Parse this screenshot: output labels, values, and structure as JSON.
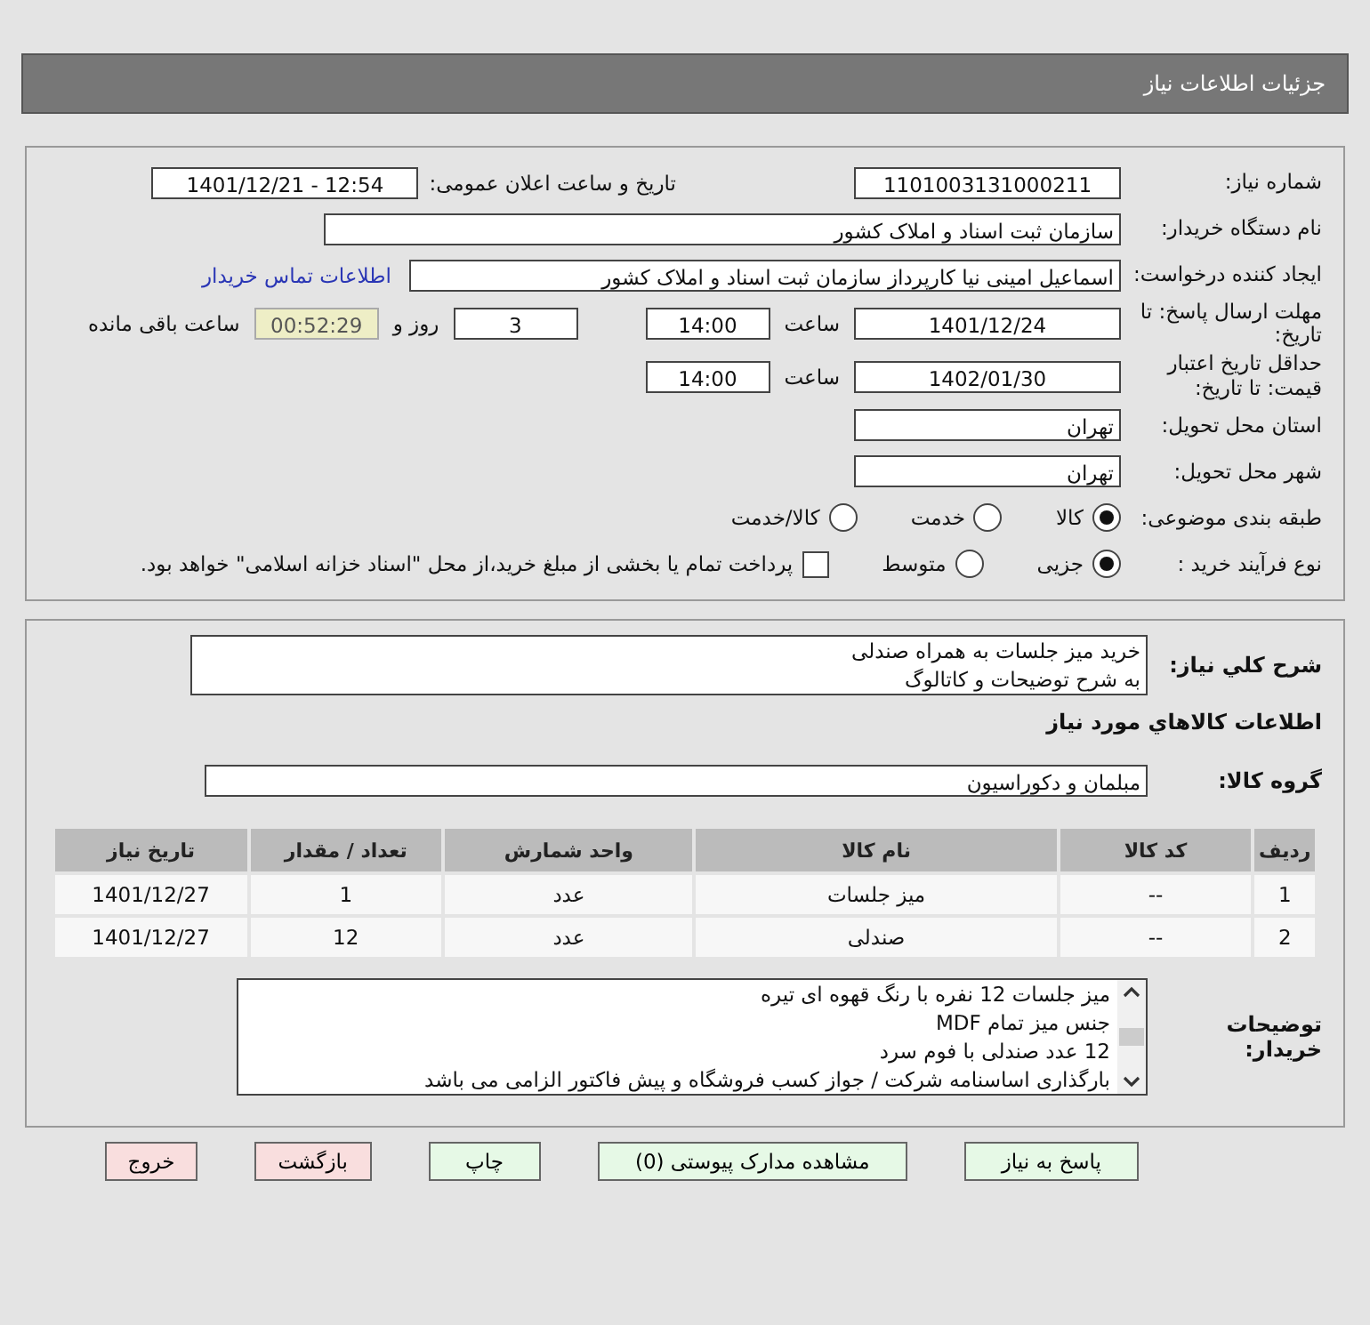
{
  "header": {
    "title": "جزئیات اطلاعات نیاز"
  },
  "details": {
    "need_number": {
      "label": "شماره نیاز:",
      "value": "1101003131000211"
    },
    "announce": {
      "label": "تاریخ و ساعت اعلان عمومی:",
      "value": "1401/12/21 - 12:54"
    },
    "buyer_org": {
      "label": "نام دستگاه خریدار:",
      "value": "سازمان ثبت اسناد و املاک کشور"
    },
    "creator": {
      "label": "ایجاد کننده درخواست:",
      "value": "اسماعیل امینی نیا کارپرداز سازمان ثبت اسناد و املاک کشور",
      "link": "اطلاعات تماس خریدار"
    },
    "deadline": {
      "label": "مهلت ارسال پاسخ: تا تاریخ:",
      "date": "1401/12/24",
      "time_label": "ساعت",
      "time": "14:00",
      "days": "3",
      "days_label": "روز و",
      "remaining": "00:52:29",
      "remaining_label": "ساعت باقی مانده"
    },
    "validity": {
      "label": "حداقل تاریخ اعتبار قیمت: تا تاریخ:",
      "date": "1402/01/30",
      "time_label": "ساعت",
      "time": "14:00"
    },
    "province": {
      "label": "استان محل تحویل:",
      "value": "تهران"
    },
    "city": {
      "label": "شهر محل تحویل:",
      "value": "تهران"
    },
    "category": {
      "label": "طبقه بندی موضوعی:",
      "options": [
        {
          "label": "کالا",
          "selected": true
        },
        {
          "label": "خدمت",
          "selected": false
        },
        {
          "label": "کالا/خدمت",
          "selected": false
        }
      ]
    },
    "process": {
      "label": "نوع فرآیند خرید :",
      "options": [
        {
          "label": "جزیی",
          "selected": true
        },
        {
          "label": "متوسط",
          "selected": false
        }
      ],
      "payment": {
        "checked": false,
        "text": "پرداخت تمام یا بخشی از مبلغ خرید،از محل \"اسناد خزانه اسلامی\" خواهد بود."
      }
    }
  },
  "goods": {
    "summary": {
      "label": "شرح کلي نياز:",
      "lines": [
        "خرید میز جلسات به همراه صندلی",
        "به شرح توضیحات و کاتالوگ"
      ]
    },
    "heading": "اطلاعات کالاهاي مورد نياز",
    "group": {
      "label": "گروه کالا:",
      "value": "مبلمان و دکوراسیون"
    },
    "table": {
      "columns": [
        "ردیف",
        "کد کالا",
        "نام کالا",
        "واحد شمارش",
        "تعداد / مقدار",
        "تاریخ نیاز"
      ],
      "rows": [
        [
          "1",
          "--",
          "میز جلسات",
          "عدد",
          "1",
          "1401/12/27"
        ],
        [
          "2",
          "--",
          "صندلی",
          "عدد",
          "12",
          "1401/12/27"
        ]
      ]
    },
    "buyer_notes": {
      "label": "توضیحات خریدار:",
      "lines": [
        "میز جلسات 12 نفره با رنگ قهوه ای تیره",
        "جنس میز تمام MDF",
        "12 عدد صندلی با فوم سرد",
        "بارگذاری اساسنامه شرکت / جواز کسب فروشگاه و پیش فاکتور الزامی می باشد"
      ]
    }
  },
  "buttons": [
    {
      "label": "پاسخ به نیاز",
      "kind": "action"
    },
    {
      "label": "مشاهده مدارک پیوستی (0)",
      "kind": "action"
    },
    {
      "label": "چاپ",
      "kind": "action"
    },
    {
      "label": "بازگشت",
      "kind": "exit"
    },
    {
      "label": "خروج",
      "kind": "exit"
    }
  ]
}
